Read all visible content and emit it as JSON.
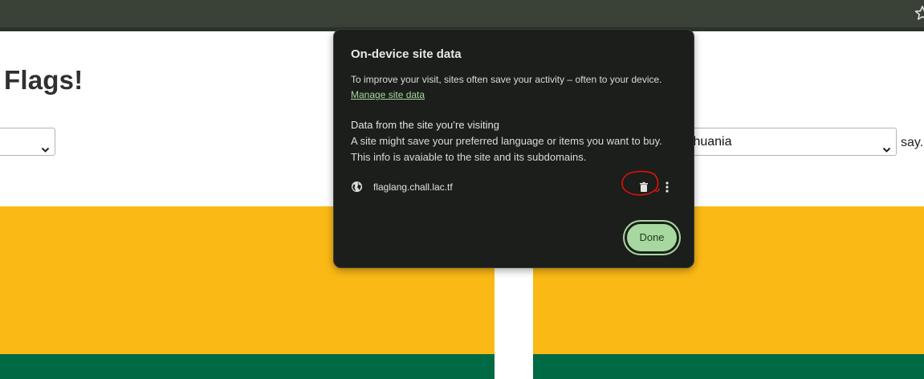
{
  "page": {
    "title": "Flags!",
    "left_select_value": "",
    "right_select_value": "thuania",
    "say_text": "say."
  },
  "popup": {
    "title": "On-device site data",
    "description": "To improve your visit, sites often save your activity – often to your device.",
    "manage_link": "Manage site data",
    "section_heading": "Data from the site you’re visiting",
    "section_line1": "A site might save your preferred language or items you want to buy.",
    "section_line2": "This info is avaiable to the site and its subdomains.",
    "site_name": "flaglang.chall.lac.tf",
    "done_label": "Done"
  },
  "icons": {
    "star": "star-icon",
    "globe": "globe-icon",
    "delete": "trash-icon",
    "more": "more-vertical-icon",
    "caret": "chevron-down-icon"
  },
  "colors": {
    "chrome_bar": "#3a4238",
    "popup_bg": "#1b1e1a",
    "link": "#a7d7a0",
    "done_button": "#a7d8a0",
    "flag_yellow": "#fbb915",
    "flag_green": "#006a44",
    "annotation_red": "#e01010"
  }
}
